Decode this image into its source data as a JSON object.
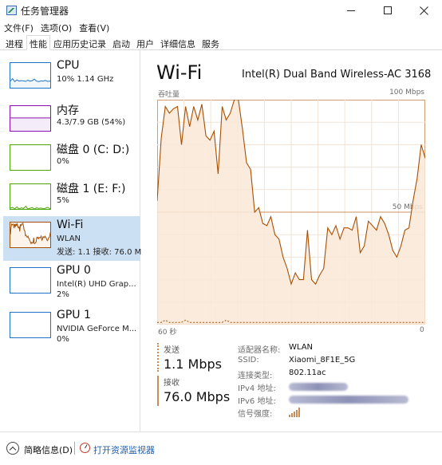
{
  "window": {
    "title": "任务管理器",
    "icon": "task-manager-icon"
  },
  "menu": [
    "文件(F)",
    "选项(O)",
    "查看(V)"
  ],
  "tabs": [
    "进程",
    "性能",
    "应用历史记录",
    "启动",
    "用户",
    "详细信息",
    "服务"
  ],
  "active_tab": "性能",
  "sidebar": [
    {
      "name": "CPU",
      "sub1": "10% 1.14 GHz",
      "sub2": "",
      "color": "#1f74c9",
      "fill": "#f1f6fb"
    },
    {
      "name": "内存",
      "sub1": "4.3/7.9 GB (54%)",
      "sub2": "",
      "color": "#8b12ae",
      "fill": "#f4ecf8"
    },
    {
      "name": "磁盘 0 (C: D:)",
      "sub1": "0%",
      "sub2": "",
      "color": "#4da60c",
      "fill": "#eff7e9"
    },
    {
      "name": "磁盘 1 (E: F:)",
      "sub1": "5%",
      "sub2": "",
      "color": "#4da60c",
      "fill": "#eff7e9"
    },
    {
      "name": "Wi-Fi",
      "sub1": "WLAN",
      "sub2": "发送: 1.1 接收: 76.0 M",
      "color": "#a74f01",
      "fill": "#fcf3eb"
    },
    {
      "name": "GPU 0",
      "sub1": "Intel(R) UHD Grap...",
      "sub2": "2%",
      "color": "#1f74c9",
      "fill": "#f1f6fb"
    },
    {
      "name": "GPU 1",
      "sub1": "NVIDIA GeForce M...",
      "sub2": "0%",
      "color": "#1f74c9",
      "fill": "#f1f6fb"
    }
  ],
  "main": {
    "title": "Wi-Fi",
    "adapter": "Intel(R) Dual Band Wireless-AC 3168",
    "throughput_label": "吞吐量",
    "max_label": "100 Mbps",
    "mid_label": "50 Mbps",
    "time_label": "60 秒",
    "zero_label": "0",
    "send_label": "发送",
    "send_value": "1.1 Mbps",
    "recv_label": "接收",
    "recv_value": "76.0 Mbps",
    "details": [
      {
        "key": "适配器名称:",
        "value": "WLAN"
      },
      {
        "key": "SSID:",
        "value": "Xiaomi_8F1E_5G"
      },
      {
        "key": "连接类型:",
        "value": "802.11ac"
      },
      {
        "key": "IPv4 地址:",
        "value": ""
      },
      {
        "key": "IPv6 地址:",
        "value": ""
      },
      {
        "key": "信号强度:",
        "value": ""
      }
    ]
  },
  "footer": {
    "fewer_details": "简略信息(D)",
    "resource_monitor": "打开资源监视器"
  },
  "chart_data": {
    "type": "area",
    "ylabel": "吞吐量",
    "ylim": [
      0,
      100
    ],
    "x_range_seconds": [
      60,
      0
    ],
    "series": [
      {
        "name": "接收",
        "color": "#a74f01",
        "values": [
          55,
          83,
          97,
          94,
          96,
          97,
          80,
          97,
          88,
          97,
          91,
          98,
          84,
          82,
          86,
          67,
          97,
          91,
          94,
          100,
          100,
          87,
          72,
          69,
          50,
          52,
          45,
          44,
          48,
          40,
          38,
          30,
          25,
          18,
          23,
          20,
          20,
          42,
          20,
          18,
          22,
          25,
          43,
          40,
          44,
          38,
          43,
          43,
          42,
          48,
          32,
          35,
          46,
          44,
          42,
          48,
          45,
          40,
          33,
          30,
          35,
          42,
          43,
          55,
          65,
          80,
          74
        ]
      },
      {
        "name": "发送",
        "color": "#a74f01",
        "dotted": true,
        "values": [
          1,
          1,
          2,
          1,
          1,
          1,
          1,
          2,
          1,
          1,
          1,
          1,
          1,
          1,
          1,
          1,
          1,
          2,
          1,
          1,
          1,
          1,
          1,
          1,
          1,
          1,
          1,
          1,
          1,
          1,
          1,
          1,
          1,
          1,
          1,
          1,
          1,
          1,
          1,
          1,
          1,
          1,
          1,
          1,
          1,
          1,
          1,
          1,
          1,
          1,
          1,
          1,
          1,
          1,
          1,
          1,
          1,
          1,
          1,
          1,
          1,
          1,
          1,
          1,
          1,
          1,
          1
        ]
      }
    ]
  }
}
